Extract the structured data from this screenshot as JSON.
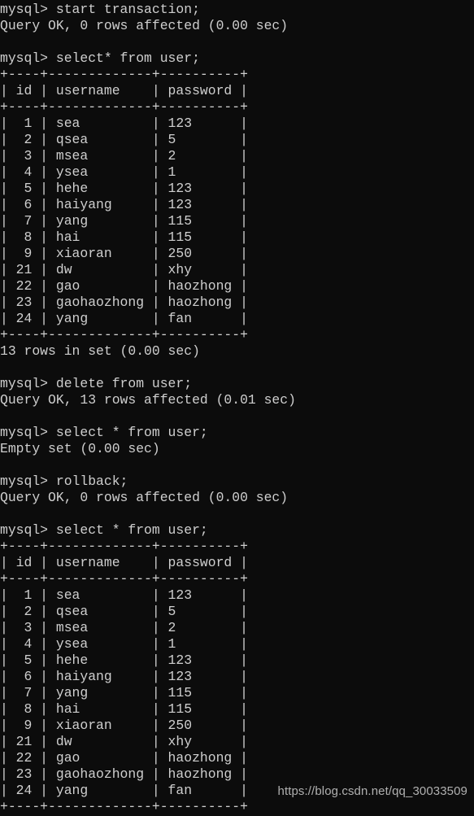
{
  "terminal": {
    "prompt": "mysql> ",
    "background_color": "#0c0c0c",
    "text_color": "#cfcfcf",
    "lines": [
      "mysql> start transaction;",
      "Query OK, 0 rows affected (0.00 sec)",
      "",
      "mysql> select* from user;",
      "+----+-------------+----------+",
      "| id | username    | password |",
      "+----+-------------+----------+",
      "|  1 | sea         | 123      |",
      "|  2 | qsea        | 5        |",
      "|  3 | msea        | 2        |",
      "|  4 | ysea        | 1        |",
      "|  5 | hehe        | 123      |",
      "|  6 | haiyang     | 123      |",
      "|  7 | yang        | 115      |",
      "|  8 | hai         | 115      |",
      "|  9 | xiaoran     | 250      |",
      "| 21 | dw          | xhy      |",
      "| 22 | gao         | haozhong |",
      "| 23 | gaohaozhong | haozhong |",
      "| 24 | yang        | fan      |",
      "+----+-------------+----------+",
      "13 rows in set (0.00 sec)",
      "",
      "mysql> delete from user;",
      "Query OK, 13 rows affected (0.01 sec)",
      "",
      "mysql> select * from user;",
      "Empty set (0.00 sec)",
      "",
      "mysql> rollback;",
      "Query OK, 0 rows affected (0.00 sec)",
      "",
      "mysql> select * from user;",
      "+----+-------------+----------+",
      "| id | username    | password |",
      "+----+-------------+----------+",
      "|  1 | sea         | 123      |",
      "|  2 | qsea        | 5        |",
      "|  3 | msea        | 2        |",
      "|  4 | ysea        | 1        |",
      "|  5 | hehe        | 123      |",
      "|  6 | haiyang     | 123      |",
      "|  7 | yang        | 115      |",
      "|  8 | hai         | 115      |",
      "|  9 | xiaoran     | 250      |",
      "| 21 | dw          | xhy      |",
      "| 22 | gao         | haozhong |",
      "| 23 | gaohaozhong | haozhong |",
      "| 24 | yang        | fan      |",
      "+----+-------------+----------+"
    ],
    "commands": [
      "start transaction;",
      "select* from user;",
      "delete from user;",
      "select * from user;",
      "rollback;",
      "select * from user;"
    ],
    "status_messages": [
      "Query OK, 0 rows affected (0.00 sec)",
      "13 rows in set (0.00 sec)",
      "Query OK, 13 rows affected (0.01 sec)",
      "Empty set (0.00 sec)",
      "Query OK, 0 rows affected (0.00 sec)"
    ],
    "result_table": {
      "separator": "+----+-------------+----------+",
      "columns": [
        "id",
        "username",
        "password"
      ],
      "rows": [
        [
          "1",
          "sea",
          "123"
        ],
        [
          "2",
          "qsea",
          "5"
        ],
        [
          "3",
          "msea",
          "2"
        ],
        [
          "4",
          "ysea",
          "1"
        ],
        [
          "5",
          "hehe",
          "123"
        ],
        [
          "6",
          "haiyang",
          "123"
        ],
        [
          "7",
          "yang",
          "115"
        ],
        [
          "8",
          "hai",
          "115"
        ],
        [
          "9",
          "xiaoran",
          "250"
        ],
        [
          "21",
          "dw",
          "xhy"
        ],
        [
          "22",
          "gao",
          "haozhong"
        ],
        [
          "23",
          "gaohaozhong",
          "haozhong"
        ],
        [
          "24",
          "yang",
          "fan"
        ]
      ],
      "row_count_label": "13 rows in set (0.00 sec)"
    }
  },
  "watermark": {
    "text": "https://blog.csdn.net/qq_30033509"
  }
}
